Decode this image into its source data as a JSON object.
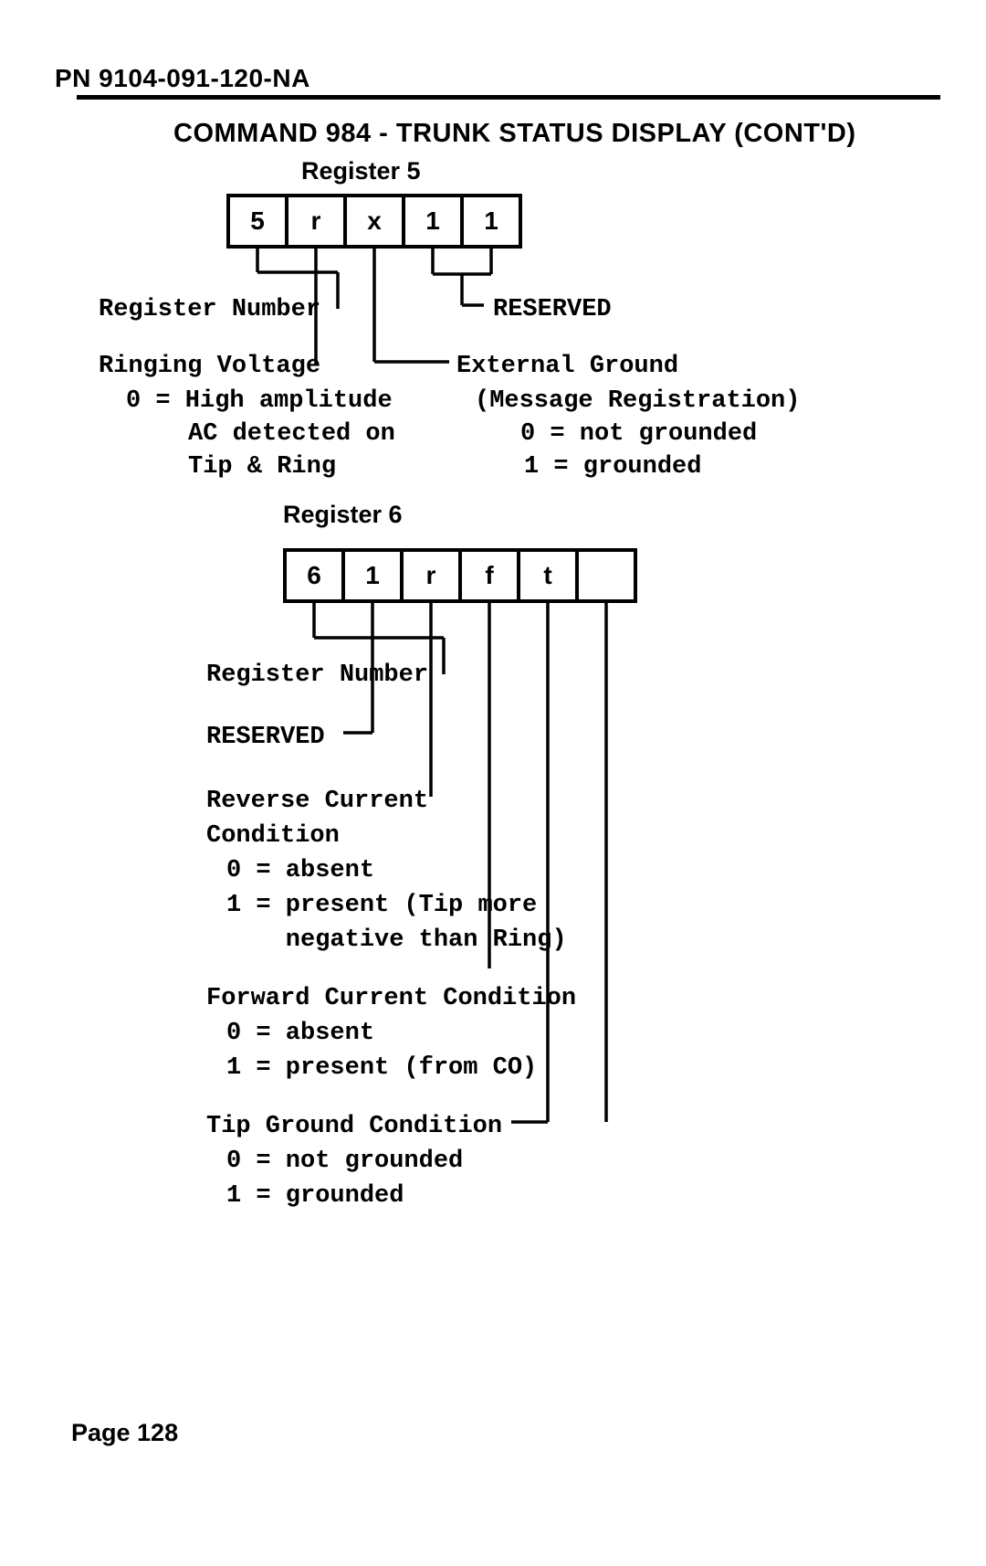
{
  "header_id": "PN 9104-091-120-NA",
  "title": "COMMAND 984 - TRUNK STATUS DISPLAY (CONT'D)",
  "page_footer": "Page 128",
  "reg5": {
    "title": "Register 5",
    "cells": [
      "5",
      "r",
      "x",
      "1",
      "1"
    ],
    "labels": {
      "register_number": "Register Number",
      "reserved": "RESERVED",
      "ringing": "Ringing Voltage",
      "ringing_line1": "0 = High amplitude",
      "ringing_line2": "AC detected on",
      "ringing_line3": "Tip & Ring",
      "extground": "External Ground",
      "extground_sub": "(Message Registration)",
      "extground_0": "0 = not grounded",
      "extground_1": "1 = grounded"
    }
  },
  "reg6": {
    "title": "Register 6",
    "cells": [
      "6",
      "1",
      "r",
      "f",
      "t",
      ""
    ],
    "labels": {
      "register_number": "Register Number",
      "reserved": "RESERVED",
      "revcur": "Reverse Current",
      "revcur_cond": "Condition",
      "revcur_0": "0 = absent",
      "revcur_1a": "1 = present (Tip more",
      "revcur_1b": "    negative than Ring)",
      "fwdcur": "Forward Current Condition",
      "fwdcur_0": "0 = absent",
      "fwdcur_1": "1 = present (from CO)",
      "tipground": "Tip Ground Condition",
      "tipground_0": "0 = not grounded",
      "tipground_1": "1 = grounded"
    }
  }
}
